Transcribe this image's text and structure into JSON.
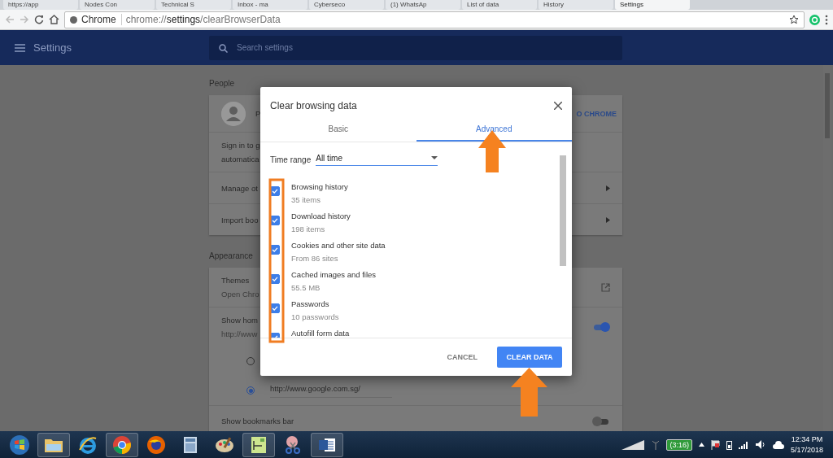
{
  "browser": {
    "tabs": [
      {
        "label": "https://app",
        "selected": false
      },
      {
        "label": "Nodes Con",
        "selected": false
      },
      {
        "label": "Technical S",
        "selected": false
      },
      {
        "label": "Inbox - ma",
        "selected": false
      },
      {
        "label": "Cyberseco",
        "selected": false
      },
      {
        "label": "(1) WhatsAp",
        "selected": false
      },
      {
        "label": "List of data",
        "selected": false
      },
      {
        "label": "History",
        "selected": false
      },
      {
        "label": "Settings",
        "selected": true
      }
    ],
    "omnibox": {
      "site": "Chrome",
      "url": "chrome://**settings**/clearBrowserData"
    }
  },
  "header": {
    "title": "Settings",
    "search": {
      "placeholder": "Search settings"
    }
  },
  "people": {
    "heading": "People",
    "profile_name": "P",
    "sign_in_button": "O CHROME",
    "rows": [
      {
        "kind": "text",
        "title": "Sign in to g",
        "subtitle": "automatica"
      },
      {
        "kind": "link",
        "title": "Manage ot"
      },
      {
        "kind": "link",
        "title": "Import boo"
      }
    ]
  },
  "appearance": {
    "heading": "Appearance",
    "themes": {
      "title": "Themes",
      "subtitle": "Open Chro"
    },
    "home_button": {
      "title": "Show hom",
      "subtitle": "http://www",
      "on": true
    },
    "home_options": [
      {
        "selected": false
      },
      {
        "selected": true,
        "value": "http://www.google.com.sg/"
      }
    ],
    "bookmarks_bar": {
      "title": "Show bookmarks bar",
      "on": false
    }
  },
  "dialog": {
    "title": "Clear browsing data",
    "tabs": [
      {
        "label": "Basic",
        "selected": false
      },
      {
        "label": "Advanced",
        "selected": true
      }
    ],
    "time_range": {
      "label": "Time range",
      "value": "All time"
    },
    "items": [
      {
        "title": "Browsing history",
        "detail": "35 items",
        "checked": true
      },
      {
        "title": "Download history",
        "detail": "198 items",
        "checked": true
      },
      {
        "title": "Cookies and other site data",
        "detail": "From 86 sites",
        "checked": true
      },
      {
        "title": "Cached images and files",
        "detail": "55.5 MB",
        "checked": true
      },
      {
        "title": "Passwords",
        "detail": "10 passwords",
        "checked": true
      },
      {
        "title": "Autofill form data",
        "checked": true
      }
    ],
    "cancel": "CANCEL",
    "confirm": "CLEAR DATA"
  },
  "taskbar": {
    "apps": [
      {
        "kind": "start",
        "running": false
      },
      {
        "kind": "folder",
        "running": true
      },
      {
        "kind": "ie",
        "running": false
      },
      {
        "kind": "chrome",
        "running": true
      },
      {
        "kind": "firefox",
        "running": false
      },
      {
        "kind": "calculator",
        "running": false
      },
      {
        "kind": "paint",
        "running": false
      },
      {
        "kind": "chart",
        "running": true
      },
      {
        "kind": "scissors",
        "running": false
      },
      {
        "kind": "word",
        "running": true
      }
    ],
    "battery": "(3:16)",
    "time": "12:34 PM",
    "date": "5/17/2018"
  }
}
